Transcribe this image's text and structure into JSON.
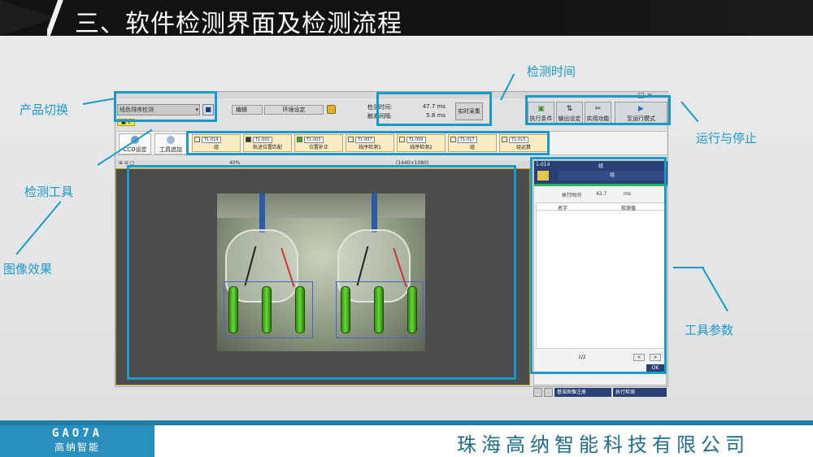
{
  "slide": {
    "title": "三、软件检测界面及检测流程",
    "company": "珠海高纳智能科技有限公司",
    "logo_en": "GAO7A",
    "logo_cn": "高纳智能",
    "accent_color": "#1a9acb"
  },
  "callouts": {
    "product_switch": "产品切换",
    "detect_time": "检测时间",
    "run_stop": "运行与停止",
    "detect_tools": "检测工具",
    "image_effect": "图像效果",
    "tool_params": "工具参数"
  },
  "app": {
    "window_controls": "— □ ×",
    "product_select": "线色排序检测",
    "edit_menu": "编辑",
    "env_button": "环境设定",
    "time": {
      "detect_label": "检测时间:",
      "detect_value": "47.7 ms",
      "trigger_label": "触发间隔:",
      "trigger_value": "5.8 ms"
    },
    "capture_button": "实时采集",
    "toolbar": {
      "exec_cond": "执行条件",
      "output_set": "输出设定",
      "practical": "实用功能",
      "run_mode": "至运行模式"
    },
    "yellow_tab": "■ 1",
    "side_buttons": {
      "ccd": "CCD设定",
      "add_tool": "工具追加"
    },
    "tools": [
      {
        "id": "T1-014",
        "name": "组"
      },
      {
        "id": "T1-002",
        "name": "轨迹位置匹配"
      },
      {
        "id": "T1-003",
        "name": "位置补正"
      },
      {
        "id": "T1-007",
        "name": "线序检测1"
      },
      {
        "id": "T1-009",
        "name": "线序检测2"
      },
      {
        "id": "T1-017",
        "name": "组"
      },
      {
        "id": "T1-015",
        "name": "组运算"
      }
    ],
    "viewer": {
      "zoom": "40%",
      "resolution": "(1440×1080)"
    },
    "panel": {
      "tool_id": "1-014",
      "tool_name": "组",
      "sub_name": "组",
      "exec_time_label": "执行时间",
      "exec_time_value": "42.7",
      "exec_time_unit": "ms",
      "col_name": "名字",
      "col_result": "检测值",
      "page": "1/2",
      "prev": "<",
      "next": ">",
      "ok": "OK"
    },
    "bottom": {
      "register_ref": "基准图像注册",
      "run_detect": "执行检测"
    }
  }
}
